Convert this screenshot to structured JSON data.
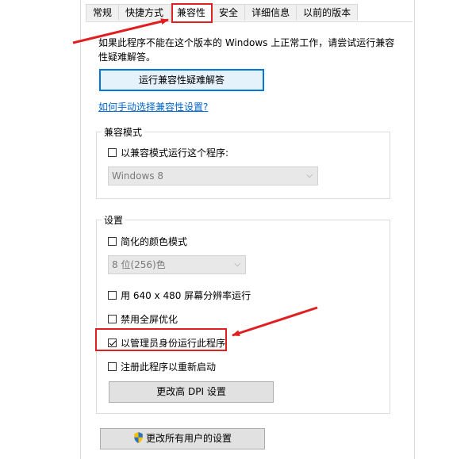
{
  "tabs": [
    "常规",
    "快捷方式",
    "兼容性",
    "安全",
    "详细信息",
    "以前的版本"
  ],
  "active_tab": "兼容性",
  "description": "如果此程序不能在这个版本的 Windows 上正常工作，请尝试运行兼容性疑难解答。",
  "troubleshoot_button": "运行兼容性疑难解答",
  "manual_link": "如何手动选择兼容性设置?",
  "compat_mode": {
    "group_title": "兼容模式",
    "checkbox_label": "以兼容模式运行这个程序:",
    "checked": false,
    "os_select": "Windows 8"
  },
  "settings": {
    "group_title": "设置",
    "reduced_color": {
      "label": "简化的颜色模式",
      "checked": false
    },
    "color_select": "8 位(256)色",
    "res640": {
      "label": "用 640 x 480 屏幕分辨率运行",
      "checked": false
    },
    "disable_fullscreen": {
      "label": "禁用全屏优化",
      "checked": false
    },
    "run_as_admin": {
      "label": "以管理员身份运行此程序",
      "checked": true
    },
    "register_restart": {
      "label": "注册此程序以重新启动",
      "checked": false
    },
    "dpi_button": "更改高 DPI 设置"
  },
  "all_users_button": "更改所有用户的设置",
  "colors": {
    "annotation_red": "#e02020",
    "link_blue": "#0066cc",
    "focus_blue": "#0078d7"
  }
}
